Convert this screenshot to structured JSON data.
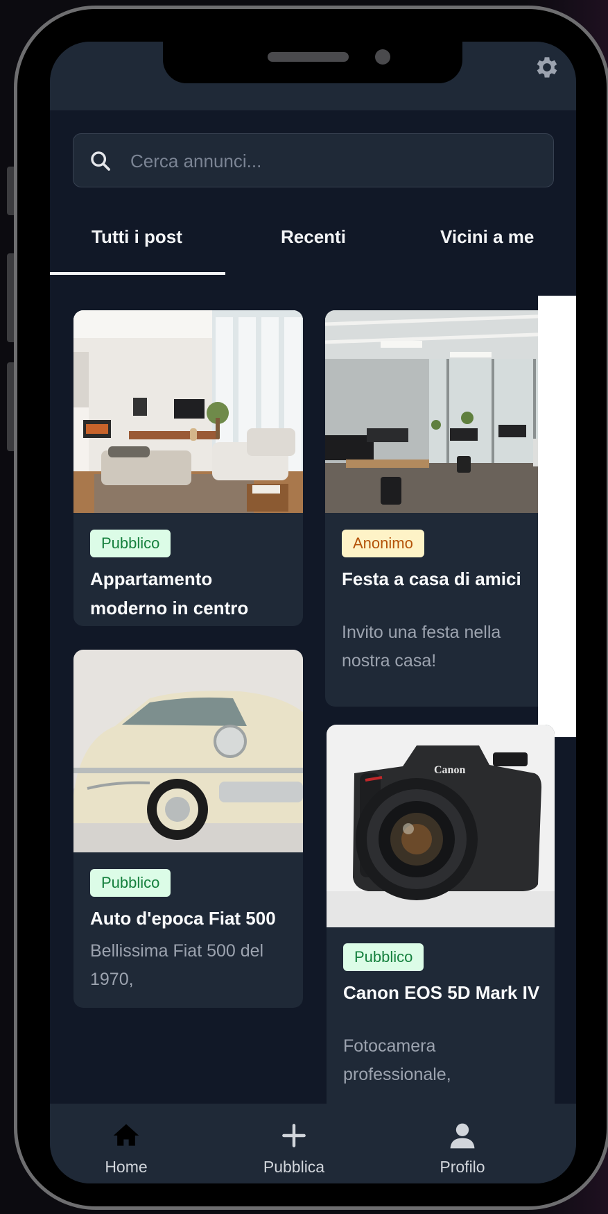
{
  "header": {
    "settings_icon": "gear-icon"
  },
  "search": {
    "placeholder": "Cerca annunci...",
    "value": "",
    "icon": "search-icon"
  },
  "tabs": [
    {
      "label": "Tutti i post",
      "active": true
    },
    {
      "label": "Recenti",
      "active": false
    },
    {
      "label": "Vicini a me",
      "active": false
    }
  ],
  "posts": [
    {
      "badge": "Pubblico",
      "title": "Appartamento moderno in centro",
      "description": "",
      "image": "living-room-photo"
    },
    {
      "badge": "Anonimo",
      "title": "Festa a casa di amici",
      "description": "Invito una festa nella nostra casa!",
      "image": "office-photo"
    },
    {
      "badge": "Pubblico",
      "title": "Auto d'epoca Fiat 500",
      "description": "Bellissima Fiat 500 del 1970,",
      "image": "vintage-car-photo"
    },
    {
      "badge": "Pubblico",
      "title": "Canon EOS 5D Mark IV",
      "description": "Fotocamera professionale,",
      "image": "camera-photo",
      "image_text": "Canon"
    }
  ],
  "bottom_nav": [
    {
      "label": "Home",
      "icon": "home-icon"
    },
    {
      "label": "Pubblica",
      "icon": "plus-icon"
    },
    {
      "label": "Profilo",
      "icon": "user-icon"
    }
  ],
  "colors": {
    "screen_bg": "#111827",
    "surface": "#1f2937",
    "text_primary": "#f9fafb",
    "text_muted": "#9ca3af",
    "badge_public_bg": "#dcfce7",
    "badge_public_fg": "#15803d",
    "badge_anon_bg": "#fef3c7",
    "badge_anon_fg": "#b45309"
  }
}
